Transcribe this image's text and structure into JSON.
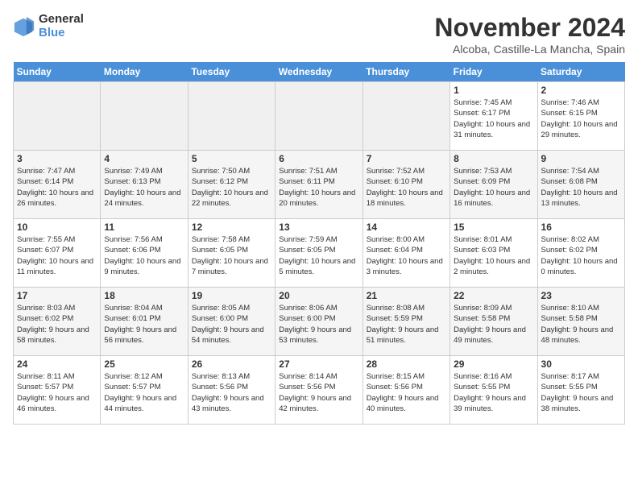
{
  "logo": {
    "general": "General",
    "blue": "Blue"
  },
  "title": "November 2024",
  "subtitle": "Alcoba, Castille-La Mancha, Spain",
  "headers": [
    "Sunday",
    "Monday",
    "Tuesday",
    "Wednesday",
    "Thursday",
    "Friday",
    "Saturday"
  ],
  "weeks": [
    [
      {
        "day": "",
        "info": ""
      },
      {
        "day": "",
        "info": ""
      },
      {
        "day": "",
        "info": ""
      },
      {
        "day": "",
        "info": ""
      },
      {
        "day": "",
        "info": ""
      },
      {
        "day": "1",
        "info": "Sunrise: 7:45 AM\nSunset: 6:17 PM\nDaylight: 10 hours and 31 minutes."
      },
      {
        "day": "2",
        "info": "Sunrise: 7:46 AM\nSunset: 6:15 PM\nDaylight: 10 hours and 29 minutes."
      }
    ],
    [
      {
        "day": "3",
        "info": "Sunrise: 7:47 AM\nSunset: 6:14 PM\nDaylight: 10 hours and 26 minutes."
      },
      {
        "day": "4",
        "info": "Sunrise: 7:49 AM\nSunset: 6:13 PM\nDaylight: 10 hours and 24 minutes."
      },
      {
        "day": "5",
        "info": "Sunrise: 7:50 AM\nSunset: 6:12 PM\nDaylight: 10 hours and 22 minutes."
      },
      {
        "day": "6",
        "info": "Sunrise: 7:51 AM\nSunset: 6:11 PM\nDaylight: 10 hours and 20 minutes."
      },
      {
        "day": "7",
        "info": "Sunrise: 7:52 AM\nSunset: 6:10 PM\nDaylight: 10 hours and 18 minutes."
      },
      {
        "day": "8",
        "info": "Sunrise: 7:53 AM\nSunset: 6:09 PM\nDaylight: 10 hours and 16 minutes."
      },
      {
        "day": "9",
        "info": "Sunrise: 7:54 AM\nSunset: 6:08 PM\nDaylight: 10 hours and 13 minutes."
      }
    ],
    [
      {
        "day": "10",
        "info": "Sunrise: 7:55 AM\nSunset: 6:07 PM\nDaylight: 10 hours and 11 minutes."
      },
      {
        "day": "11",
        "info": "Sunrise: 7:56 AM\nSunset: 6:06 PM\nDaylight: 10 hours and 9 minutes."
      },
      {
        "day": "12",
        "info": "Sunrise: 7:58 AM\nSunset: 6:05 PM\nDaylight: 10 hours and 7 minutes."
      },
      {
        "day": "13",
        "info": "Sunrise: 7:59 AM\nSunset: 6:05 PM\nDaylight: 10 hours and 5 minutes."
      },
      {
        "day": "14",
        "info": "Sunrise: 8:00 AM\nSunset: 6:04 PM\nDaylight: 10 hours and 3 minutes."
      },
      {
        "day": "15",
        "info": "Sunrise: 8:01 AM\nSunset: 6:03 PM\nDaylight: 10 hours and 2 minutes."
      },
      {
        "day": "16",
        "info": "Sunrise: 8:02 AM\nSunset: 6:02 PM\nDaylight: 10 hours and 0 minutes."
      }
    ],
    [
      {
        "day": "17",
        "info": "Sunrise: 8:03 AM\nSunset: 6:02 PM\nDaylight: 9 hours and 58 minutes."
      },
      {
        "day": "18",
        "info": "Sunrise: 8:04 AM\nSunset: 6:01 PM\nDaylight: 9 hours and 56 minutes."
      },
      {
        "day": "19",
        "info": "Sunrise: 8:05 AM\nSunset: 6:00 PM\nDaylight: 9 hours and 54 minutes."
      },
      {
        "day": "20",
        "info": "Sunrise: 8:06 AM\nSunset: 6:00 PM\nDaylight: 9 hours and 53 minutes."
      },
      {
        "day": "21",
        "info": "Sunrise: 8:08 AM\nSunset: 5:59 PM\nDaylight: 9 hours and 51 minutes."
      },
      {
        "day": "22",
        "info": "Sunrise: 8:09 AM\nSunset: 5:58 PM\nDaylight: 9 hours and 49 minutes."
      },
      {
        "day": "23",
        "info": "Sunrise: 8:10 AM\nSunset: 5:58 PM\nDaylight: 9 hours and 48 minutes."
      }
    ],
    [
      {
        "day": "24",
        "info": "Sunrise: 8:11 AM\nSunset: 5:57 PM\nDaylight: 9 hours and 46 minutes."
      },
      {
        "day": "25",
        "info": "Sunrise: 8:12 AM\nSunset: 5:57 PM\nDaylight: 9 hours and 44 minutes."
      },
      {
        "day": "26",
        "info": "Sunrise: 8:13 AM\nSunset: 5:56 PM\nDaylight: 9 hours and 43 minutes."
      },
      {
        "day": "27",
        "info": "Sunrise: 8:14 AM\nSunset: 5:56 PM\nDaylight: 9 hours and 42 minutes."
      },
      {
        "day": "28",
        "info": "Sunrise: 8:15 AM\nSunset: 5:56 PM\nDaylight: 9 hours and 40 minutes."
      },
      {
        "day": "29",
        "info": "Sunrise: 8:16 AM\nSunset: 5:55 PM\nDaylight: 9 hours and 39 minutes."
      },
      {
        "day": "30",
        "info": "Sunrise: 8:17 AM\nSunset: 5:55 PM\nDaylight: 9 hours and 38 minutes."
      }
    ]
  ]
}
